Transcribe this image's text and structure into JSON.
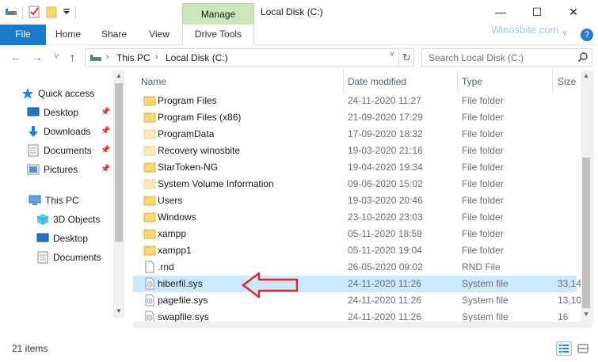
{
  "window": {
    "title": "Local Disk (C:)",
    "manage_tab": "Manage",
    "min_glyph": "—",
    "max_glyph": "☐",
    "close_glyph": "✕"
  },
  "ribbon": {
    "file": "File",
    "tabs": [
      "Home",
      "Share",
      "View"
    ],
    "drive_tools": "Drive Tools",
    "watermark": "Winosbite.com",
    "collapse_glyph": "˅",
    "help": "?"
  },
  "address": {
    "back": "←",
    "forward": "→",
    "recent": "˅",
    "up": "↑",
    "segments": [
      "This PC",
      "Local Disk (C:)"
    ],
    "chevron": "›",
    "dropdown": "˅",
    "refresh": "↻",
    "search_placeholder": "Search Local Disk (C:)"
  },
  "nav": {
    "quick_access": "Quick access",
    "quick_items": [
      "Desktop",
      "Downloads",
      "Documents",
      "Pictures"
    ],
    "this_pc": "This PC",
    "pc_items": [
      "3D Objects",
      "Desktop",
      "Documents"
    ]
  },
  "columns": {
    "name": "Name",
    "date": "Date modified",
    "type": "Type",
    "size": "Size"
  },
  "files": [
    {
      "name": "Program Files",
      "date": "24-11-2020 11:27",
      "type": "File folder",
      "size": "",
      "icon": "folder-icon"
    },
    {
      "name": "Program Files (x86)",
      "date": "21-09-2020 17:29",
      "type": "File folder",
      "size": "",
      "icon": "folder-icon"
    },
    {
      "name": "ProgramData",
      "date": "17-09-2020 18:32",
      "type": "File folder",
      "size": "",
      "icon": "folder-faded-icon"
    },
    {
      "name": "Recovery winosbite",
      "date": "19-03-2020 21:16",
      "type": "File folder",
      "size": "",
      "icon": "folder-faded-icon"
    },
    {
      "name": "StarToken-NG",
      "date": "19-04-2020 19:34",
      "type": "File folder",
      "size": "",
      "icon": "folder-icon"
    },
    {
      "name": "System Volume Information",
      "date": "09-06-2020 15:02",
      "type": "File folder",
      "size": "",
      "icon": "folder-faded-icon"
    },
    {
      "name": "Users",
      "date": "19-03-2020 20:46",
      "type": "File folder",
      "size": "",
      "icon": "folder-icon"
    },
    {
      "name": "Windows",
      "date": "23-10-2020 23:03",
      "type": "File folder",
      "size": "",
      "icon": "folder-icon"
    },
    {
      "name": "xampp",
      "date": "05-11-2020 18:59",
      "type": "File folder",
      "size": "",
      "icon": "folder-icon"
    },
    {
      "name": "xampp1",
      "date": "05-11-2020 19:04",
      "type": "File folder",
      "size": "",
      "icon": "folder-icon"
    },
    {
      "name": ".rnd",
      "date": "26-05-2020 09:02",
      "type": "RND File",
      "size": "",
      "icon": "file-icon"
    },
    {
      "name": "hiberfil.sys",
      "date": "24-11-2020 11:26",
      "type": "System file",
      "size": "33,14",
      "icon": "system-file-icon",
      "selected": true
    },
    {
      "name": "pagefile.sys",
      "date": "24-11-2020 11:26",
      "type": "System file",
      "size": "13,10",
      "icon": "system-file-icon"
    },
    {
      "name": "swapfile.sys",
      "date": "24-11-2020 11:26",
      "type": "System file",
      "size": "16",
      "icon": "system-file-icon"
    }
  ],
  "status": {
    "item_count": "21 items"
  },
  "colors": {
    "file_tab": "#1979ca",
    "manage_tab": "#c9e7b8",
    "selected_row": "#cce8ff",
    "callout_arrow": "#e0262b"
  }
}
